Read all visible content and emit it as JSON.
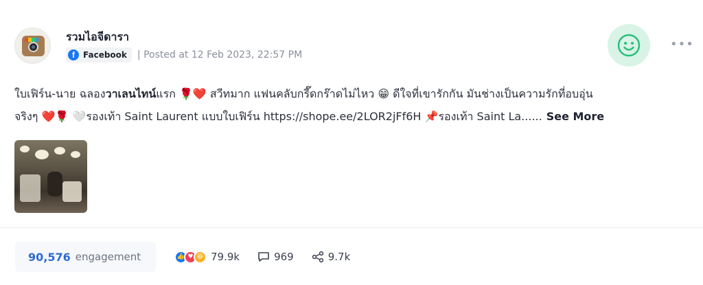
{
  "post": {
    "author": "รวมไอจีดารา",
    "platform_label": "Facebook",
    "posted": "| Posted at 12 Feb 2023, 22:57 PM",
    "more_label": "•••",
    "text_segments": {
      "line1_a": "ใบเฟิร์น-นาย ฉลอง",
      "line1_bold": "วาเลนไทน์",
      "line1_b": "แรก 🌹❤️ สวีทมาก แฟนคลับกรี๊ดกร๊าดไม่ไหว 😁 ดีใจที่เขารักกัน มันช่างเป็นความรักที่อบอุ่น",
      "line2": "จริงๆ ❤️🌹 🤍รองเท้า Saint Laurent แบบใบเฟิร์น https://shope.ee/2LOR2jFf6H 📌รองเท้า Saint La......"
    },
    "see_more": "See More"
  },
  "footer": {
    "engagement_value": "90,576",
    "engagement_label": "engagement",
    "reactions_count": "79.9k",
    "comments_count": "969",
    "shares_count": "9.7k"
  },
  "colors": {
    "facebook": "#1877f2",
    "sentiment_bg": "#d9f3e6",
    "sentiment_icon": "#27c07a",
    "engagement_num": "#2d6bd1"
  },
  "icons": {
    "sentiment": "smiley-positive-icon",
    "reactions": [
      "like-icon",
      "love-icon",
      "haha-icon"
    ],
    "comments": "comment-icon",
    "shares": "share-icon"
  }
}
